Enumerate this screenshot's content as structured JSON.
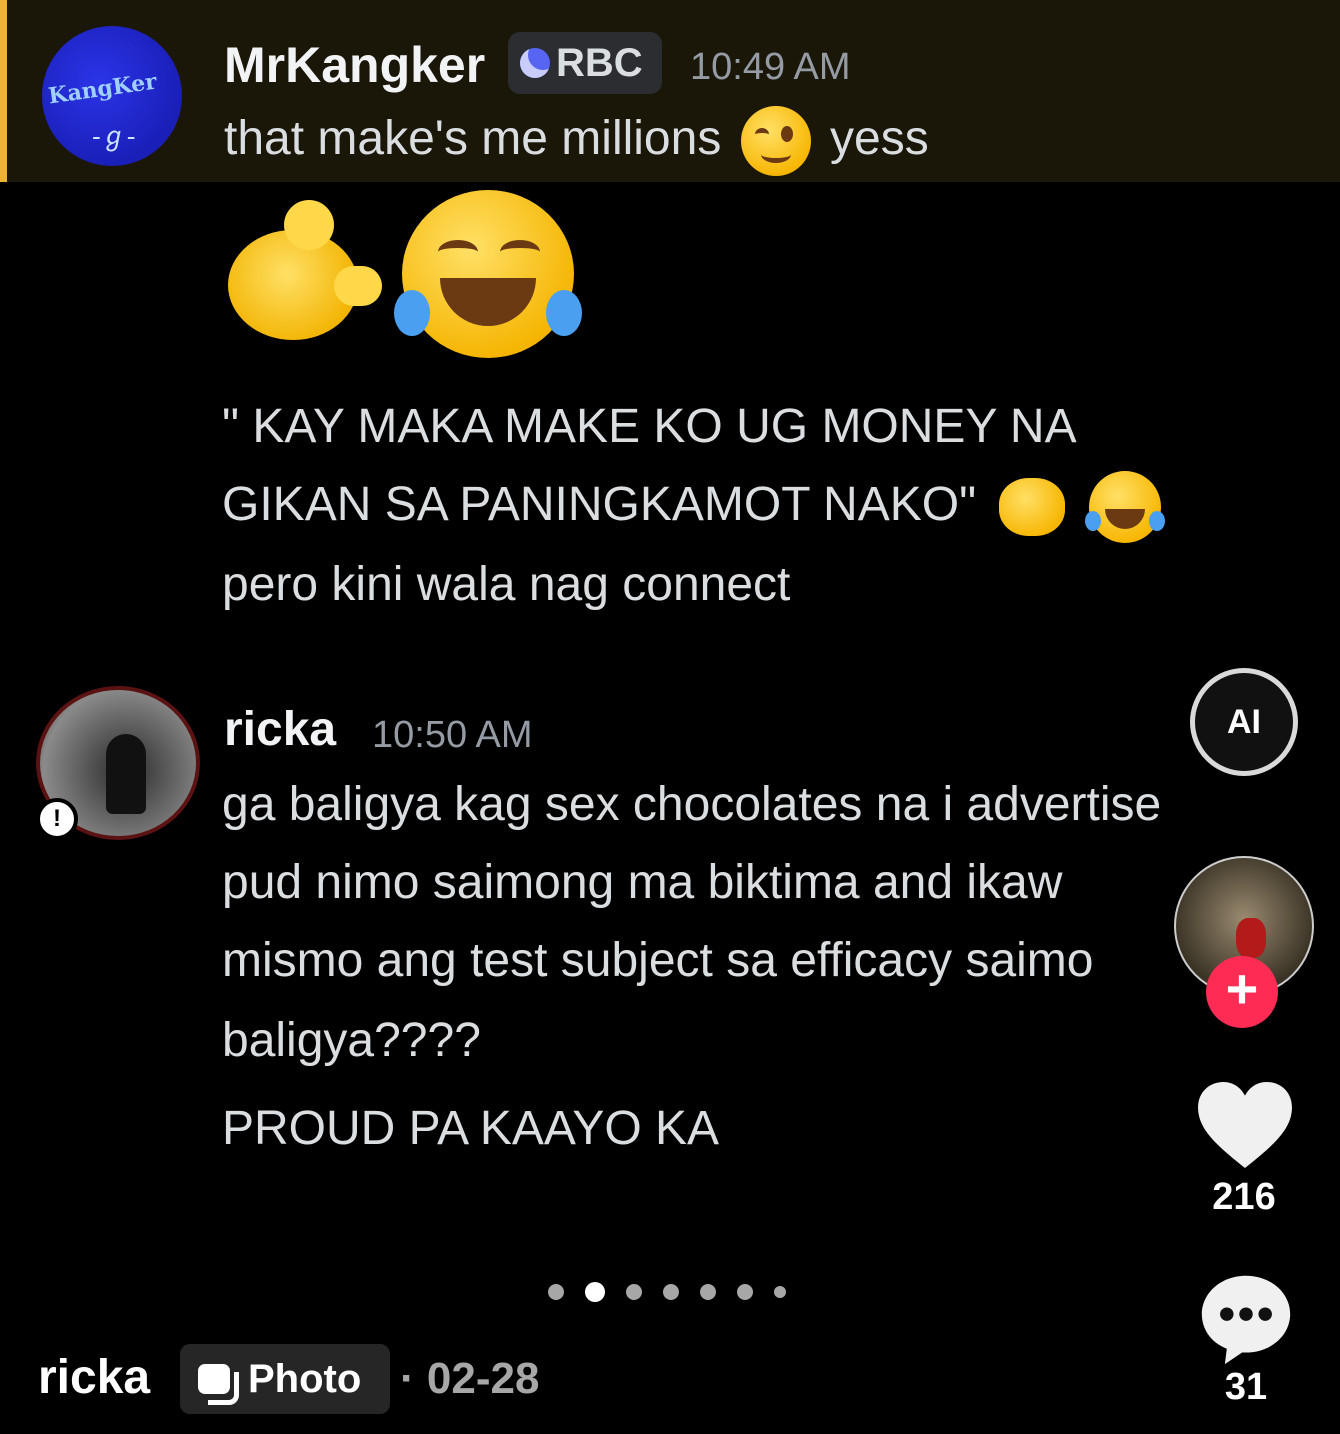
{
  "message1": {
    "username": "MrKangker",
    "tag_label": "RBC",
    "time": "10:49 AM",
    "text_before_emoji": "that make's me millions",
    "text_after_emoji": "yess",
    "avatar_logo_text": "KangKer",
    "avatar_sig": "-ℊ-"
  },
  "message1_cont": {
    "line1": "\" KAY MAKA MAKE KO UG MONEY NA",
    "line2": "GIKAN SA PANINGKAMOT NAKO\"",
    "line3": "pero kini wala nag connect"
  },
  "message2": {
    "username": "ricka",
    "time": "10:50 AM",
    "line1": "ga baligya kag sex chocolates na i advertise",
    "line2": "pud nimo saimong ma biktima and ikaw",
    "line3": "mismo ang test subject sa efficacy saimo",
    "line4": "baligya????",
    "line5": "PROUD PA KAAYO KA",
    "warn_badge": "!"
  },
  "sidebar": {
    "ai_label": "AI",
    "follow_label": "+",
    "likes": "216",
    "comments": "31"
  },
  "footer": {
    "author": "ricka",
    "type_label": "Photo",
    "separator": "·",
    "date": "02-28"
  },
  "carousel": {
    "count": 7,
    "active_index": 1
  },
  "colors": {
    "highlight_bar": "#f0b232",
    "follow_pink": "#fe2c55",
    "discord_blurple": "#5865f2"
  }
}
